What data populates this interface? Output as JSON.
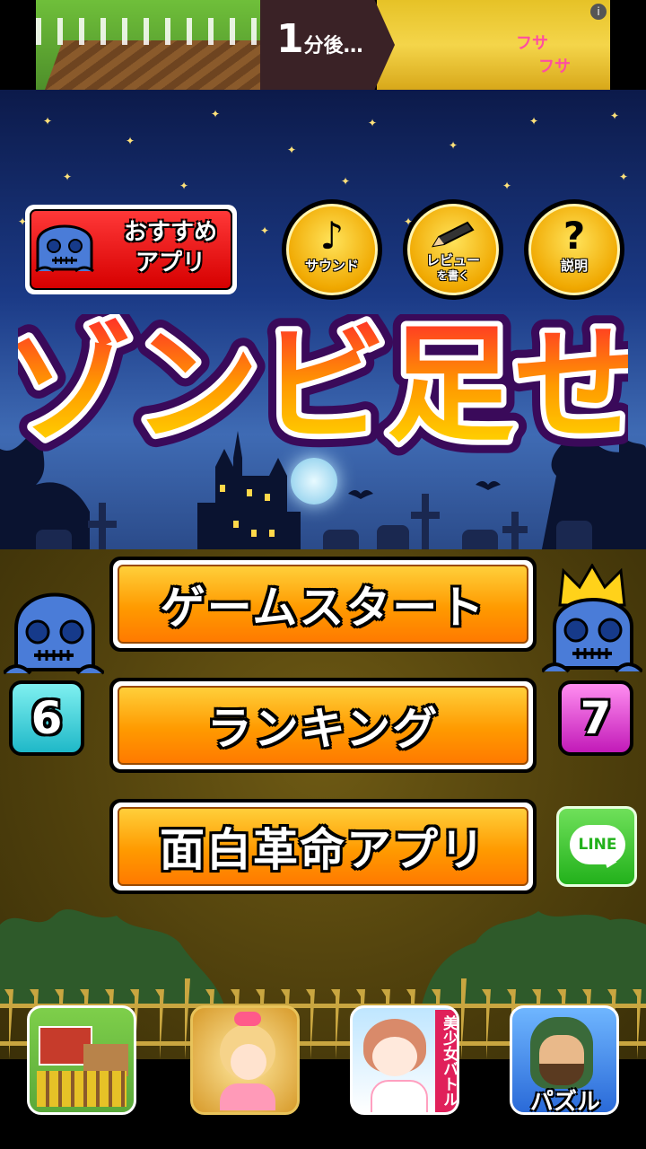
{
  "ad": {
    "text_number": "1",
    "text_rest": "分後…",
    "sparkle_1": "フサ",
    "sparkle_2": "フサ",
    "info_icon": "info-icon"
  },
  "header": {
    "recommend_label_1": "おすすめ",
    "recommend_label_2": "アプリ",
    "sound_label": "サウンド",
    "review_label_1": "レビュー",
    "review_label_2": "を書く",
    "help_label": "説明",
    "help_glyph": "?"
  },
  "title": {
    "text": "ゾンビ足せ"
  },
  "menu": {
    "start_label": "ゲームスタート",
    "ranking_label": "ランキング",
    "apps_label": "面白革命アプリ"
  },
  "scores": {
    "left_value": "6",
    "right_value": "7"
  },
  "line": {
    "label": "LINE"
  },
  "bottom_apps": {
    "app3_label": "美少女バトル",
    "app4_label": "パズル"
  },
  "colors": {
    "button_orange": "#ff9a00",
    "recommend_red": "#e00000",
    "badge_cyan": "#2fd6d6",
    "badge_magenta": "#e33ad8",
    "line_green": "#22b11b"
  }
}
